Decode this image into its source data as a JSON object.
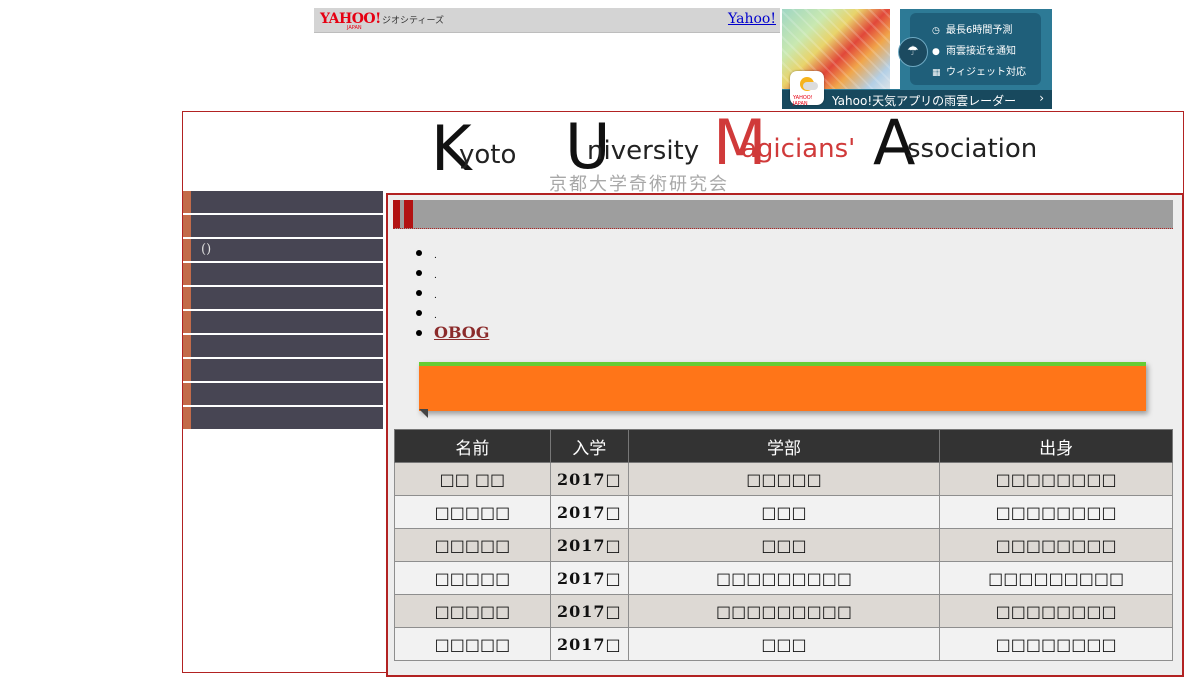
{
  "yahoo_bar": {
    "logo": "YAHOO!",
    "logo_sub": "JAPAN",
    "geocities": "ジオシティーズ",
    "link": "Yahoo!"
  },
  "ad": {
    "features": [
      "最長6時間予測",
      "雨雲接近を通知",
      "ウィジェット対応"
    ],
    "app_label": "YAHOO! JAPAN",
    "cta": "Yahoo!天気アプリの雨雲レーダー",
    "chevron": "›",
    "colors": {
      "background": "#2d7a96",
      "panel": "#1f5f7a"
    }
  },
  "banner": {
    "k_big": "K",
    "k_small": "yoto",
    "u_big": "U",
    "u_small": "niversity",
    "m_big": "M",
    "m_small": "agicians'",
    "a_big": "A",
    "a_small": "ssociation",
    "japanese": "京都大学奇術研究会",
    "colors": {
      "black": "#111111",
      "red": "#d03a3a"
    }
  },
  "sidebar": {
    "items": [
      {
        "label": ""
      },
      {
        "label": ""
      },
      {
        "label": "()"
      },
      {
        "label": ""
      },
      {
        "label": ""
      },
      {
        "label": ""
      },
      {
        "label": ""
      },
      {
        "label": ""
      },
      {
        "label": ""
      },
      {
        "label": ""
      }
    ],
    "colors": {
      "item_bg": "#474553",
      "accent": "#c26b4a"
    }
  },
  "content": {
    "links": [
      ".",
      ".",
      ".",
      "."
    ],
    "obog_link": "OBOG",
    "ribbon_colors": {
      "fill": "#ff7518",
      "top": "#66cc33"
    },
    "table": {
      "headers": [
        "名前",
        "入学",
        "学部",
        "出身"
      ],
      "rows": [
        [
          "□□ □□",
          "2017□",
          "□□□□□",
          "□□□□□□□□"
        ],
        [
          "□□□□□",
          "2017□",
          "□□□",
          "□□□□□□□□"
        ],
        [
          "□□□□□",
          "2017□",
          "□□□",
          "□□□□□□□□"
        ],
        [
          "□□□□□",
          "2017□",
          "□□□□□□□□□",
          "□□□□□□□□□"
        ],
        [
          "□□□□□",
          "2017□",
          "□□□□□□□□□",
          "□□□□□□□□"
        ],
        [
          "□□□□□",
          "2017□",
          "□□□",
          "□□□□□□□□"
        ]
      ]
    }
  }
}
